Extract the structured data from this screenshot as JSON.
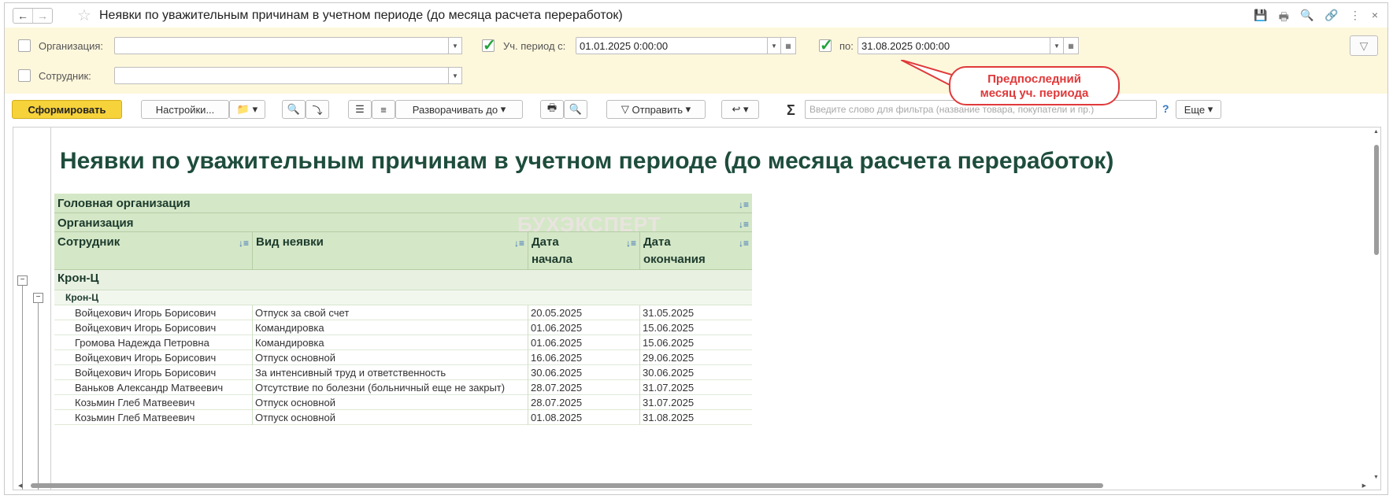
{
  "window": {
    "title": "Неявки по уважительным причинам в учетном периоде (до месяца расчета переработок)",
    "nav_back_icon": "←",
    "nav_forward_icon": "→",
    "favorite_icon": "☆",
    "title_icons": [
      "💾",
      "🖶",
      "🔍",
      "🔗",
      "⋮",
      "×"
    ]
  },
  "filters": {
    "organization_label": "Организация:",
    "organization_value": "",
    "employee_label": "Сотрудник:",
    "employee_value": "",
    "period_from_label": "Уч. период с:",
    "period_from_value": "01.01.2025  0:00:00",
    "period_to_label": "по:",
    "period_to_value": "31.08.2025  0:00:00",
    "period_from_checked": true,
    "period_to_checked": true
  },
  "toolbar": {
    "generate_label": "Сформировать",
    "settings_label": "Настройки...",
    "expand_label": "Разворачивать до",
    "send_label": "Отправить",
    "filter_placeholder": "Введите слово для фильтра (название товара, покупатели и пр.)",
    "help_label": "?",
    "more_label": "Еще"
  },
  "callout": {
    "line1": "Предпоследний",
    "line2": "месяц уч. периода"
  },
  "report": {
    "title": "Неявки по уважительным причинам в учетном периоде (до месяца расчета переработок)",
    "watermark": "БУХЭКСПЕРТ",
    "header_head_org": "Головная организация",
    "header_org": "Организация",
    "col_employee": "Сотрудник",
    "col_type": "Вид неявки",
    "col_start_1": "Дата",
    "col_start_2": "начала",
    "col_end_1": "Дата",
    "col_end_2": "окончания",
    "group1": "Крон-Ц",
    "group2": "Крон-Ц",
    "rows": [
      {
        "employee": "Войцехович Игорь Борисович",
        "type": "Отпуск за свой счет",
        "start": "20.05.2025",
        "end": "31.05.2025"
      },
      {
        "employee": "Войцехович Игорь Борисович",
        "type": "Командировка",
        "start": "01.06.2025",
        "end": "15.06.2025"
      },
      {
        "employee": "Громова Надежда Петровна",
        "type": "Командировка",
        "start": "01.06.2025",
        "end": "15.06.2025"
      },
      {
        "employee": "Войцехович Игорь Борисович",
        "type": "Отпуск основной",
        "start": "16.06.2025",
        "end": "29.06.2025"
      },
      {
        "employee": "Войцехович Игорь Борисович",
        "type": "За интенсивный труд и ответственность",
        "start": "30.06.2025",
        "end": "30.06.2025"
      },
      {
        "employee": "Ваньков Александр Матвеевич",
        "type": "Отсутствие по болезни (больничный еще не закрыт)",
        "start": "28.07.2025",
        "end": "31.07.2025"
      },
      {
        "employee": "Козьмин Глеб Матвеевич",
        "type": "Отпуск основной",
        "start": "28.07.2025",
        "end": "31.07.2025"
      },
      {
        "employee": "Козьмин Глеб Матвеевич",
        "type": "Отпуск основной",
        "start": "01.08.2025",
        "end": "31.08.2025"
      }
    ]
  },
  "colors": {
    "accent_yellow": "#f6d23b",
    "filter_bg": "#fdf7dc",
    "header_green": "#d4e7c7",
    "title_green": "#1e4d3c",
    "callout_red": "#e0393a",
    "check_green": "#22a339"
  }
}
